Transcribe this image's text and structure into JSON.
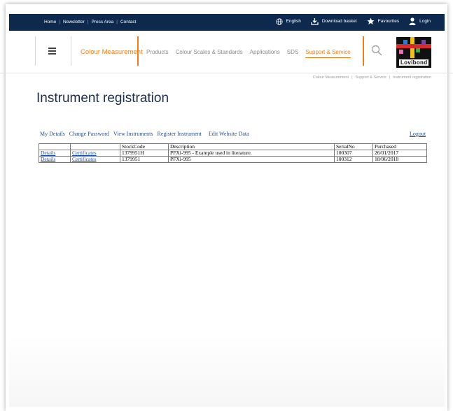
{
  "topbar": {
    "links": [
      "Home",
      "Newsletter",
      "Press Area",
      "Contact"
    ],
    "language": "English",
    "download_basket": "Download basket",
    "favourites": "Favourites",
    "login": "Login"
  },
  "header": {
    "brand_link": "Colour Measurement",
    "nav": [
      "Products",
      "Colour Scales & Standards",
      "Applications",
      "SDS",
      "Support & Service"
    ],
    "logo_text": "Lovibond"
  },
  "breadcrumb": [
    "Colour Measurement",
    "Support & Service",
    "Instrument registration"
  ],
  "page_title": "Instrument registration",
  "subnav": [
    "My Details",
    "Change Password",
    "View Instruments",
    "Register Instrument",
    "Edit Website Data"
  ],
  "logout": "Logout",
  "table": {
    "headers": [
      "",
      "",
      "StockCode",
      "Description",
      "SerialNo",
      "Purchased"
    ],
    "rows": [
      [
        "Details",
        "Certificates",
        "1379951H",
        "PFXi-995 - Example used in literature.",
        "100307",
        "26/01/2017"
      ],
      [
        "Details",
        "Certificates",
        "1379951",
        "PFXi-995",
        "100312",
        "18/06/2018"
      ]
    ]
  },
  "colors": {
    "navy": "#0d2a4e",
    "orange": "#f07d1b",
    "link": "#1e4fb4"
  }
}
